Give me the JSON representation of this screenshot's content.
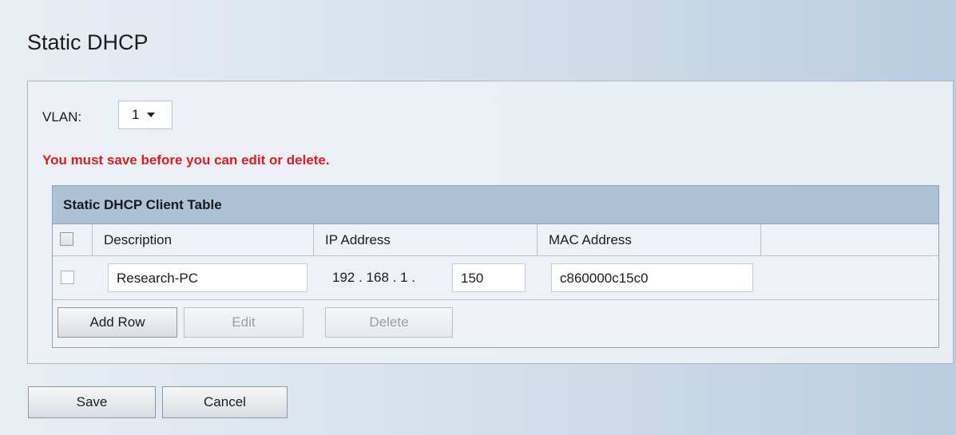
{
  "page": {
    "title": "Static DHCP"
  },
  "vlan": {
    "label": "VLAN:",
    "selected": "1"
  },
  "warning": "You must save before you can edit or delete.",
  "table": {
    "title": "Static DHCP Client Table",
    "headers": [
      "Description",
      "IP Address",
      "MAC Address",
      ""
    ],
    "rows": [
      {
        "checked": false,
        "description": "Research-PC",
        "ip_prefix": "192 . 168 . 1 .",
        "ip_last_octet": "150",
        "mac": "c860000c15c0"
      }
    ],
    "buttons": {
      "add_row": "Add Row",
      "edit": "Edit",
      "delete": "Delete"
    }
  },
  "footer": {
    "save": "Save",
    "cancel": "Cancel"
  }
}
